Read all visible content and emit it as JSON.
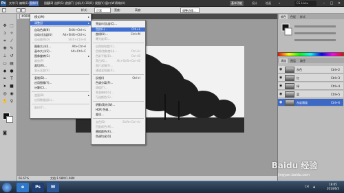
{
  "app": {
    "logo": "Ps"
  },
  "menubar": {
    "items": [
      "文件(F)",
      "编辑(E)",
      "图像(I)",
      "图层(L)",
      "选择(S)",
      "滤镜(T)",
      "分析(A)",
      "3D(D)",
      "视图(V)",
      "窗口(W)",
      "帮助(H)"
    ],
    "active_index": 2,
    "zoom": "66.7",
    "workspaces": [
      "基本功能",
      "设计",
      "绘画"
    ],
    "more": "»",
    "search": "CS Live▾"
  },
  "options": {
    "label1": "样式:",
    "select1": "正常",
    "label2": "宽度:",
    "label3": "高度:",
    "edge_button": "调整边缘..."
  },
  "document": {
    "tab": "#000017",
    "zoom": "66.67%",
    "info": "文档:1.98M/1.98M"
  },
  "image_menu": {
    "items": [
      {
        "label": "模式(M)",
        "shortcut": "",
        "arrow": true,
        "disabled": false,
        "hl": false
      },
      {
        "label": "调整(J)",
        "shortcut": "",
        "arrow": true,
        "disabled": false,
        "hl": true
      },
      {
        "label": "自动色调(N)",
        "shortcut": "Shift+Ctrl+L",
        "arrow": false,
        "disabled": false,
        "hl": false
      },
      {
        "label": "自动对比度(U)",
        "shortcut": "Alt+Shift+Ctrl+L",
        "arrow": false,
        "disabled": false,
        "hl": false
      },
      {
        "label": "自动颜色(O)",
        "shortcut": "Shift+Ctrl+B",
        "arrow": false,
        "disabled": true,
        "hl": false
      },
      {
        "label": "图像大小(I)...",
        "shortcut": "Alt+Ctrl+I",
        "arrow": false,
        "disabled": false,
        "hl": false
      },
      {
        "label": "画布大小(S)...",
        "shortcut": "Alt+Ctrl+C",
        "arrow": false,
        "disabled": false,
        "hl": false
      },
      {
        "label": "图像旋转(G)",
        "shortcut": "",
        "arrow": true,
        "disabled": false,
        "hl": false
      },
      {
        "label": "裁剪(P)",
        "shortcut": "",
        "arrow": false,
        "disabled": true,
        "hl": false
      },
      {
        "label": "裁切(R)...",
        "shortcut": "",
        "arrow": false,
        "disabled": false,
        "hl": false
      },
      {
        "label": "显示全部(V)",
        "shortcut": "",
        "arrow": false,
        "disabled": true,
        "hl": false
      },
      {
        "label": "复制(D)...",
        "shortcut": "",
        "arrow": false,
        "disabled": false,
        "hl": false
      },
      {
        "label": "应用图像(Y)...",
        "shortcut": "",
        "arrow": false,
        "disabled": false,
        "hl": false
      },
      {
        "label": "计算(C)...",
        "shortcut": "",
        "arrow": false,
        "disabled": false,
        "hl": false
      },
      {
        "label": "变量(B)",
        "shortcut": "",
        "arrow": true,
        "disabled": true,
        "hl": false
      },
      {
        "label": "应用数据组(L)...",
        "shortcut": "",
        "arrow": false,
        "disabled": true,
        "hl": false
      },
      {
        "label": "陷印(T)...",
        "shortcut": "",
        "arrow": false,
        "disabled": true,
        "hl": false
      }
    ]
  },
  "adjust_menu": {
    "items": [
      {
        "label": "亮度/对比度(C)...",
        "shortcut": "",
        "disabled": false,
        "hl": false
      },
      {
        "label": "色阶(L)...",
        "shortcut": "Ctrl+L",
        "disabled": false,
        "hl": true
      },
      {
        "label": "曲线(U)...",
        "shortcut": "Ctrl+M",
        "disabled": false,
        "hl": false
      },
      {
        "label": "曝光度(E)...",
        "shortcut": "",
        "disabled": true,
        "hl": false
      },
      {
        "label": "自然饱和度(V)...",
        "shortcut": "",
        "disabled": true,
        "hl": false
      },
      {
        "label": "色相/饱和度(H)...",
        "shortcut": "Ctrl+U",
        "disabled": true,
        "hl": false
      },
      {
        "label": "色彩平衡(B)...",
        "shortcut": "Ctrl+B",
        "disabled": true,
        "hl": false
      },
      {
        "label": "黑白(K)...",
        "shortcut": "Alt+Shift+Ctrl+B",
        "disabled": true,
        "hl": false
      },
      {
        "label": "照片滤镜(F)...",
        "shortcut": "",
        "disabled": true,
        "hl": false
      },
      {
        "label": "通道混和器(X)...",
        "shortcut": "",
        "disabled": true,
        "hl": false
      },
      {
        "label": "反相(I)",
        "shortcut": "Ctrl+I",
        "disabled": false,
        "hl": false
      },
      {
        "label": "色调分离(P)...",
        "shortcut": "",
        "disabled": false,
        "hl": false
      },
      {
        "label": "阈值(T)...",
        "shortcut": "",
        "disabled": true,
        "hl": false
      },
      {
        "label": "渐变映射(G)...",
        "shortcut": "",
        "disabled": true,
        "hl": false
      },
      {
        "label": "可选颜色(S)...",
        "shortcut": "",
        "disabled": true,
        "hl": false
      },
      {
        "label": "阴影/高光(W)...",
        "shortcut": "",
        "disabled": false,
        "hl": false
      },
      {
        "label": "HDR 色调...",
        "shortcut": "",
        "disabled": false,
        "hl": false
      },
      {
        "label": "变化...",
        "shortcut": "",
        "disabled": false,
        "hl": false
      },
      {
        "label": "去色(D)",
        "shortcut": "Shift+Ctrl+U",
        "disabled": true,
        "hl": false
      },
      {
        "label": "匹配颜色(M)...",
        "shortcut": "",
        "disabled": true,
        "hl": false
      },
      {
        "label": "替换颜色(R)...",
        "shortcut": "",
        "disabled": false,
        "hl": false
      },
      {
        "label": "色调均化(Q)",
        "shortcut": "",
        "disabled": false,
        "hl": false
      }
    ]
  },
  "right_panel": {
    "tabs": [
      "颜色",
      "色板",
      "样式"
    ],
    "layer_tabs": [
      "通道",
      "图层",
      "路径"
    ],
    "layers": [
      {
        "name": "灰色",
        "shortcut": "Ctrl+2"
      },
      {
        "name": "红",
        "shortcut": "Ctrl+3"
      },
      {
        "name": "绿",
        "shortcut": "Ctrl+4"
      },
      {
        "name": "蓝",
        "shortcut": "Ctrl+5"
      },
      {
        "name": "灰度通道",
        "shortcut": "Ctrl+6"
      }
    ]
  },
  "taskbar": {
    "apps": [
      "e",
      "Ps",
      "W"
    ],
    "tray": [
      "CH",
      "▲"
    ],
    "time": "18:05",
    "date": "2014/6/3"
  },
  "watermark": {
    "title": "Baidu 经验",
    "url": "jingyan.baidu.com"
  },
  "colors": {
    "menu_bg": "#353535",
    "highlight": "#3f6fd3",
    "workspace": "#9b9b9b"
  }
}
